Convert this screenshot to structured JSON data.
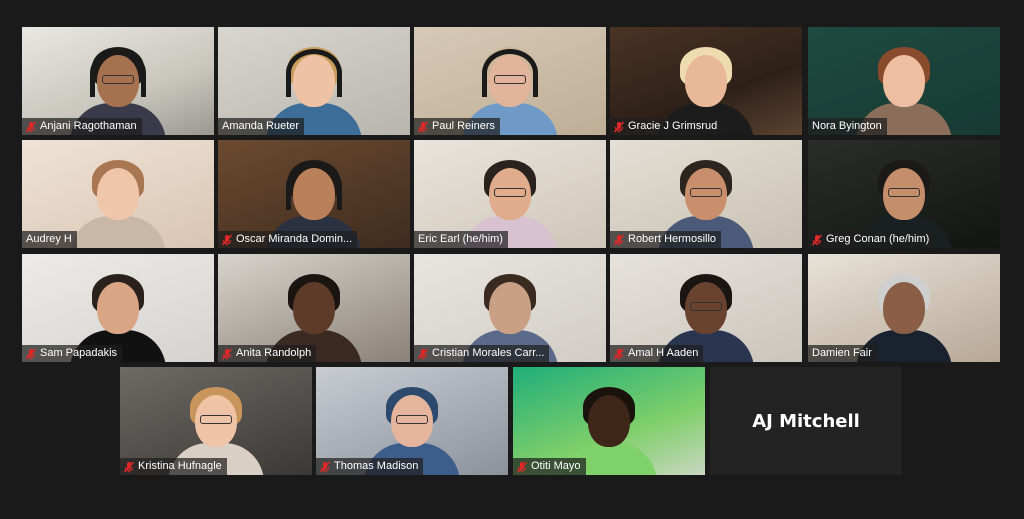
{
  "app": {
    "view": "Gallery View"
  },
  "colors": {
    "background": "#1a1a1a",
    "active_speaker_border": "#a7e03d",
    "muted_icon": "#e02828",
    "nametag_text": "#ffffff"
  },
  "participants": [
    {
      "name": "Anjani Ragothaman",
      "muted": true,
      "video": true,
      "active": false
    },
    {
      "name": "Amanda Rueter",
      "muted": false,
      "video": true,
      "active": true
    },
    {
      "name": "Paul Reiners",
      "muted": true,
      "video": true,
      "active": false
    },
    {
      "name": "Gracie J Grimsrud",
      "muted": true,
      "video": true,
      "active": false
    },
    {
      "name": "Nora Byington",
      "muted": false,
      "video": true,
      "active": false
    },
    {
      "name": "Audrey H",
      "muted": false,
      "video": true,
      "active": false
    },
    {
      "name": "Oscar Miranda Domin...",
      "muted": true,
      "video": true,
      "active": false
    },
    {
      "name": "Eric Earl (he/him)",
      "muted": false,
      "video": true,
      "active": false
    },
    {
      "name": "Robert Hermosillo",
      "muted": true,
      "video": true,
      "active": false
    },
    {
      "name": "Greg Conan (he/him)",
      "muted": true,
      "video": true,
      "active": false
    },
    {
      "name": "Sam Papadakis",
      "muted": true,
      "video": true,
      "active": false
    },
    {
      "name": "Anita Randolph",
      "muted": true,
      "video": true,
      "active": false
    },
    {
      "name": "Cristian Morales Carr...",
      "muted": true,
      "video": true,
      "active": false
    },
    {
      "name": "Amal H Aaden",
      "muted": true,
      "video": true,
      "active": false
    },
    {
      "name": "Damien Fair",
      "muted": false,
      "video": true,
      "active": false
    },
    {
      "name": "Kristina Hufnagle",
      "muted": true,
      "video": true,
      "active": false
    },
    {
      "name": "Thomas Madison",
      "muted": true,
      "video": true,
      "active": false
    },
    {
      "name": "Otiti Mayo",
      "muted": true,
      "video": true,
      "active": false
    },
    {
      "name": "AJ Mitchell",
      "muted": false,
      "video": false,
      "active": false
    }
  ]
}
